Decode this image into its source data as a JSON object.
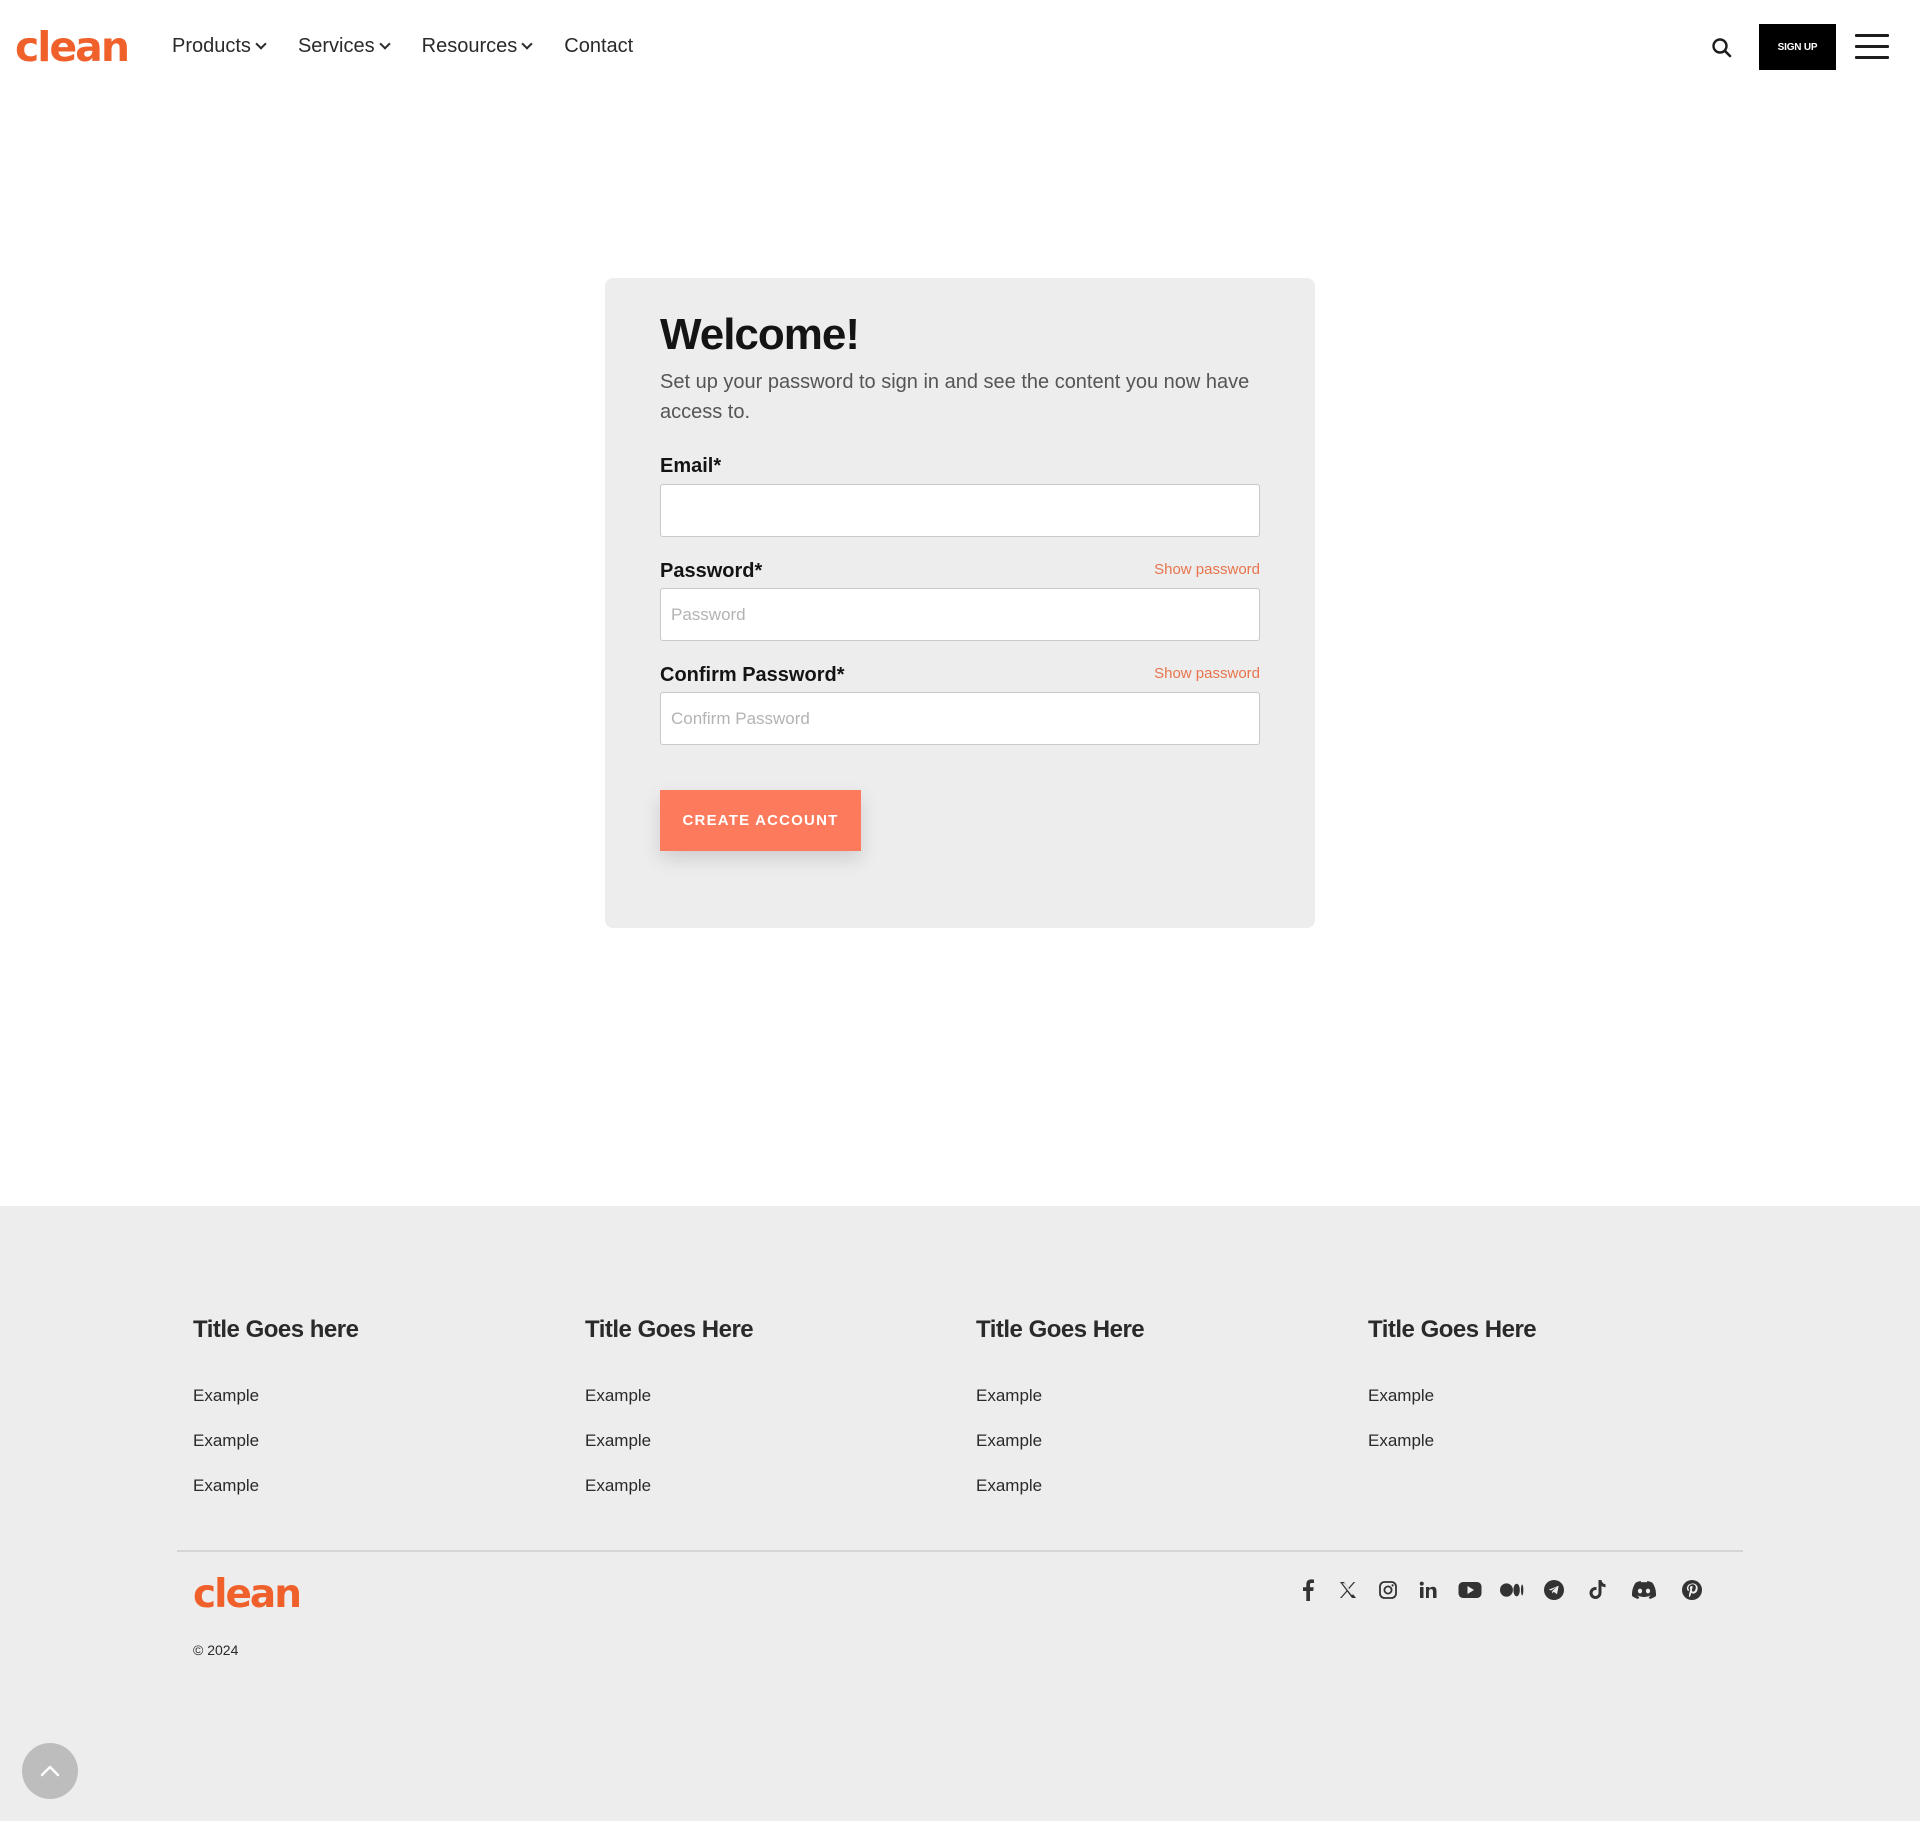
{
  "header": {
    "logo": "clean",
    "nav": [
      {
        "label": "Products",
        "dropdown": true
      },
      {
        "label": "Services",
        "dropdown": true
      },
      {
        "label": "Resources",
        "dropdown": true
      },
      {
        "label": "Contact",
        "dropdown": false
      }
    ],
    "signup_label": "SIGN UP",
    "icons": {
      "search": "search-icon",
      "menu": "hamburger-menu-icon"
    }
  },
  "form": {
    "title": "Welcome!",
    "subtitle": "Set up your password to sign in and see the content you now have access to.",
    "email": {
      "label": "Email*",
      "value": "",
      "placeholder": ""
    },
    "password": {
      "label": "Password*",
      "placeholder": "Password",
      "value": "",
      "show_label": "Show password"
    },
    "confirm_password": {
      "label": "Confirm Password*",
      "placeholder": "Confirm Password",
      "value": "",
      "show_label": "Show password"
    },
    "submit_label": "CREATE ACCOUNT"
  },
  "footer": {
    "columns": [
      {
        "title": "Title Goes here",
        "links": [
          "Example",
          "Example",
          "Example"
        ]
      },
      {
        "title": "Title Goes Here",
        "links": [
          "Example",
          "Example",
          "Example"
        ]
      },
      {
        "title": "Title Goes Here",
        "links": [
          "Example",
          "Example",
          "Example"
        ]
      },
      {
        "title": "Title Goes Here",
        "links": [
          "Example",
          "Example"
        ]
      }
    ],
    "logo": "clean",
    "copyright": "© 2024",
    "socials": [
      "facebook-icon",
      "x-icon",
      "instagram-icon",
      "linkedin-icon",
      "youtube-icon",
      "medium-icon",
      "telegram-icon",
      "tiktok-icon",
      "discord-icon",
      "pinterest-icon"
    ]
  },
  "colors": {
    "brand": "#f0602b",
    "button": "#fe7a5c",
    "link_accent": "#e8744d",
    "card_bg": "#ededed",
    "footer_bg": "#ededed"
  }
}
